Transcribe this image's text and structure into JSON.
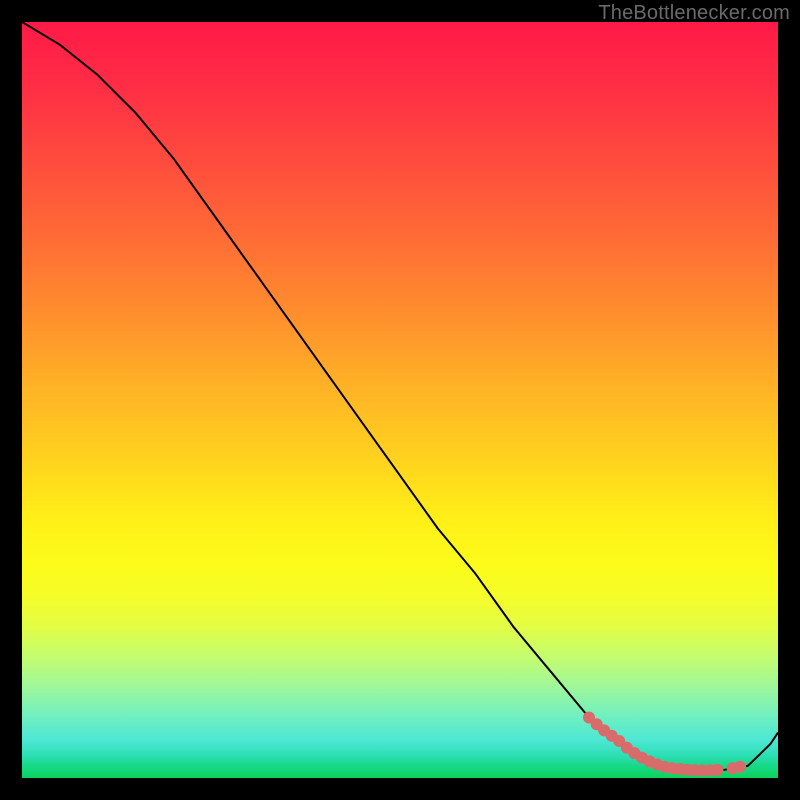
{
  "watermark": "TheBottlenecker.com",
  "chart_data": {
    "type": "line",
    "title": "",
    "xlabel": "",
    "ylabel": "",
    "xlim": [
      0,
      100
    ],
    "ylim": [
      0,
      100
    ],
    "series": [
      {
        "name": "bottleneck-curve",
        "x": [
          0,
          5,
          10,
          15,
          20,
          25,
          30,
          35,
          40,
          45,
          50,
          55,
          60,
          65,
          70,
          75,
          80,
          83,
          86,
          90,
          93,
          96,
          99,
          100
        ],
        "y": [
          100,
          97,
          93,
          88,
          82,
          75,
          68,
          61,
          54,
          47,
          40,
          33,
          27,
          20,
          14,
          8,
          4,
          2.2,
          1.3,
          1.0,
          1.1,
          1.6,
          4.5,
          6
        ],
        "color": "#000000",
        "width": 2
      },
      {
        "name": "highlight-markers",
        "x": [
          75,
          76,
          77,
          78,
          79,
          80,
          81,
          82,
          83,
          84,
          85,
          86,
          87,
          88,
          89,
          90,
          91,
          92,
          94,
          95
        ],
        "y": [
          8.0,
          7.1,
          6.3,
          5.6,
          4.9,
          4.0,
          3.3,
          2.7,
          2.2,
          1.8,
          1.5,
          1.3,
          1.2,
          1.1,
          1.05,
          1.0,
          1.02,
          1.07,
          1.3,
          1.5
        ],
        "color": "#d96b6b",
        "marker_radius": 6
      }
    ],
    "background_gradient_stops": [
      {
        "pos": 0.0,
        "color": "#ff1a47"
      },
      {
        "pos": 0.4,
        "color": "#ff8c2e"
      },
      {
        "pos": 0.66,
        "color": "#fff018"
      },
      {
        "pos": 0.88,
        "color": "#9ef79b"
      },
      {
        "pos": 1.0,
        "color": "#0ad35d"
      }
    ]
  }
}
